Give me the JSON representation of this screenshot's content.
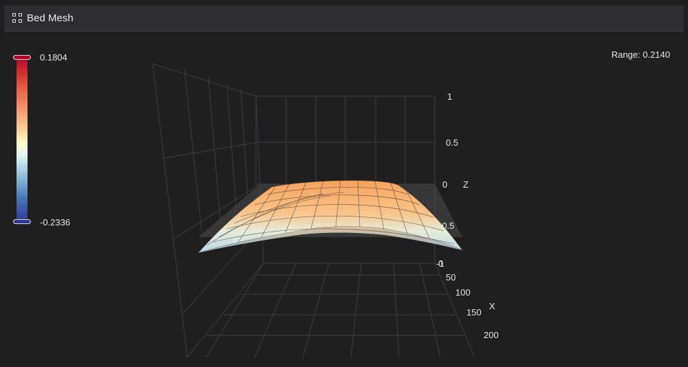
{
  "header": {
    "title": "Bed Mesh",
    "icon": "grid-icon"
  },
  "colorscale": {
    "max_label": "0.1804",
    "min_label": "-0.2336",
    "max_color": "#b40426",
    "min_color": "#313695"
  },
  "range_label": "Range: 0.2140",
  "plot": {
    "z_ticks": [
      "1",
      "0.5",
      "0",
      "-0.5",
      "-1"
    ],
    "z_axis_label": "Z",
    "x_ticks": [
      "50",
      "100",
      "150",
      "200"
    ],
    "x_axis_label": "X",
    "x_zero_tick": "0"
  }
}
